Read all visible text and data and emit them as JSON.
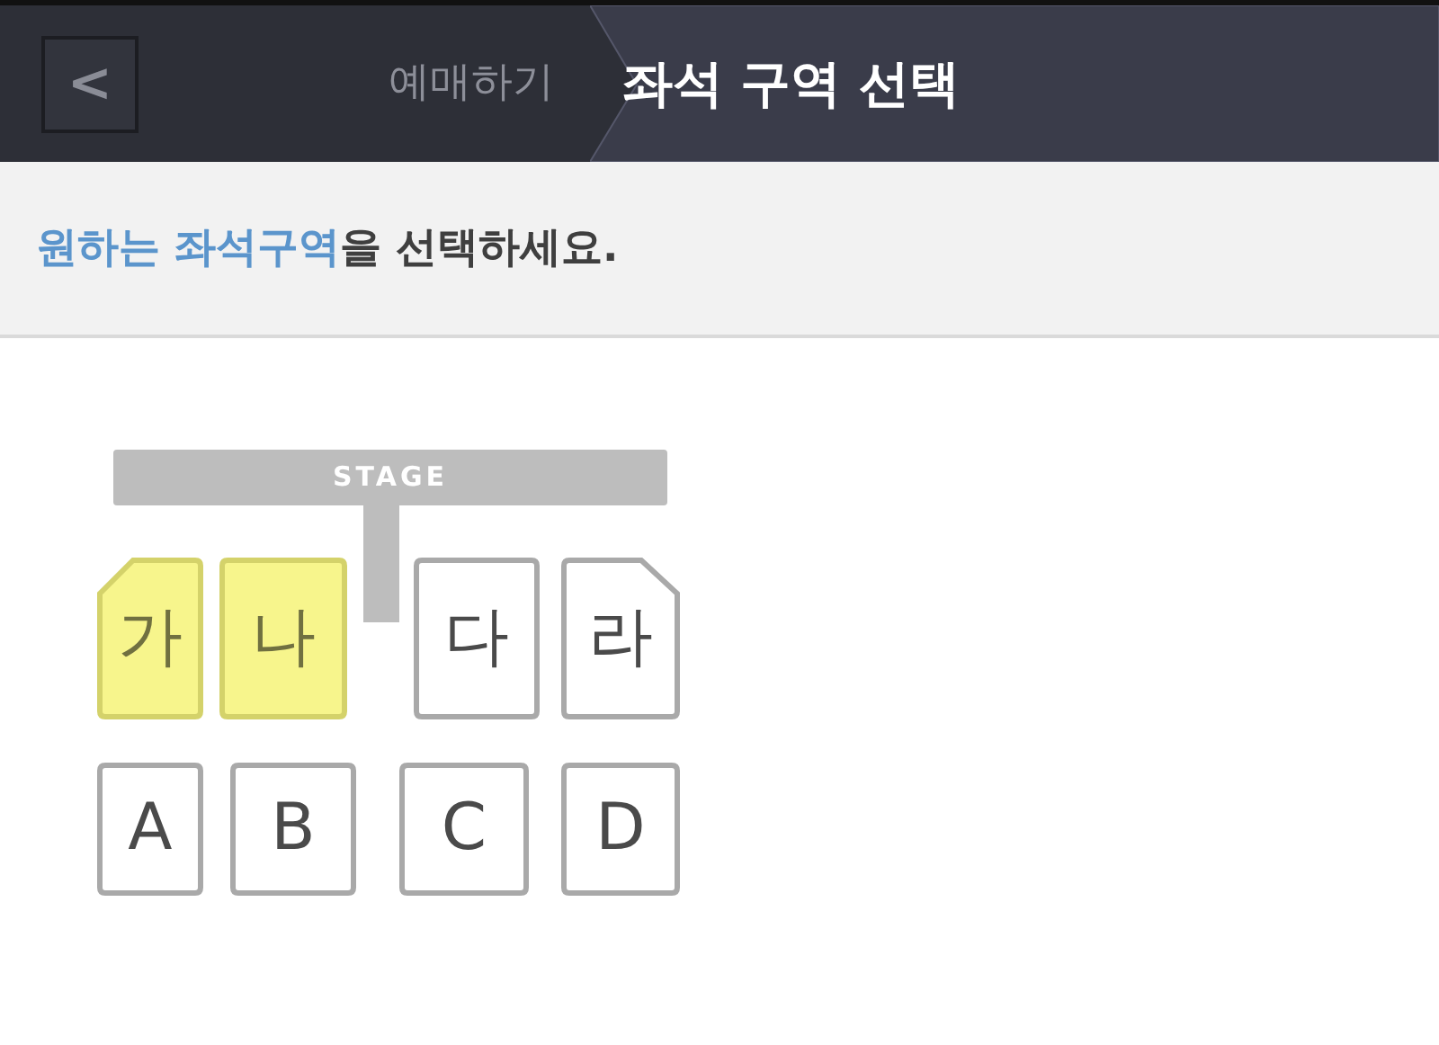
{
  "header": {
    "back_label": "<",
    "breadcrumb": "예매하기",
    "title": "좌석 구역 선택"
  },
  "instruction": {
    "highlight": "원하는 좌석구역",
    "rest": "을 선택하세요."
  },
  "stage": {
    "label": "STAGE"
  },
  "sections": [
    {
      "label": "가",
      "kind": "corner-left",
      "selected": true
    },
    {
      "label": "나",
      "kind": "square",
      "selected": true
    },
    {
      "label": "다",
      "kind": "square",
      "selected": false
    },
    {
      "label": "라",
      "kind": "corner-right",
      "selected": false
    },
    {
      "label": "A",
      "kind": "square",
      "selected": false
    },
    {
      "label": "B",
      "kind": "square",
      "selected": false
    },
    {
      "label": "C",
      "kind": "square",
      "selected": false
    },
    {
      "label": "D",
      "kind": "square",
      "selected": false
    }
  ]
}
